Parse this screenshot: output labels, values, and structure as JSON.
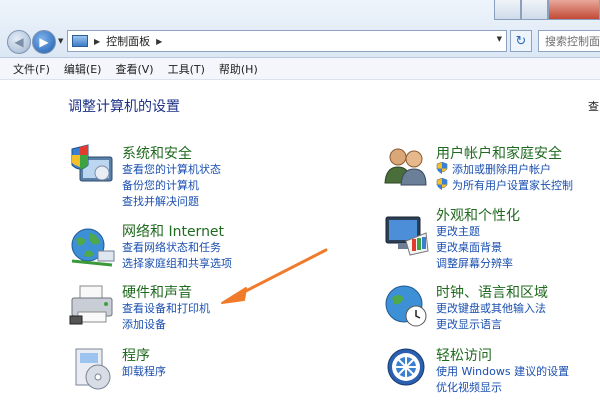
{
  "address": {
    "crumb": "控制面板",
    "search_placeholder": "搜索控制面板"
  },
  "menu": [
    "文件(F)",
    "编辑(E)",
    "查看(V)",
    "工具(T)",
    "帮助(H)"
  ],
  "heading": "调整计算机的设置",
  "viewby_fragment": "查",
  "categories": [
    {
      "title": "系统和安全",
      "icon": "shield-computer-icon",
      "links": [
        "查看您的计算机状态",
        "备份您的计算机",
        "查找并解决问题"
      ]
    },
    {
      "title": "用户帐户和家庭安全",
      "icon": "users-icon",
      "links": [
        "添加或删除用户帐户",
        "为所有用户设置家长控制"
      ]
    },
    {
      "title": "网络和 Internet",
      "icon": "network-globe-icon",
      "links": [
        "查看网络状态和任务",
        "选择家庭组和共享选项"
      ]
    },
    {
      "title": "外观和个性化",
      "icon": "monitor-palette-icon",
      "links": [
        "更改主题",
        "更改桌面背景",
        "调整屏幕分辨率"
      ]
    },
    {
      "title": "硬件和声音",
      "icon": "printer-icon",
      "links": [
        "查看设备和打印机",
        "添加设备"
      ]
    },
    {
      "title": "时钟、语言和区域",
      "icon": "clock-globe-icon",
      "links": [
        "更改键盘或其他输入法",
        "更改显示语言"
      ]
    },
    {
      "title": "程序",
      "icon": "programs-icon",
      "links": [
        "卸载程序"
      ]
    },
    {
      "title": "轻松访问",
      "icon": "ease-of-access-icon",
      "links": [
        "使用 Windows 建议的设置",
        "优化视频显示"
      ]
    }
  ],
  "annotation": {
    "color": "#f07b2a",
    "points_to": "查看设备和打印机"
  }
}
